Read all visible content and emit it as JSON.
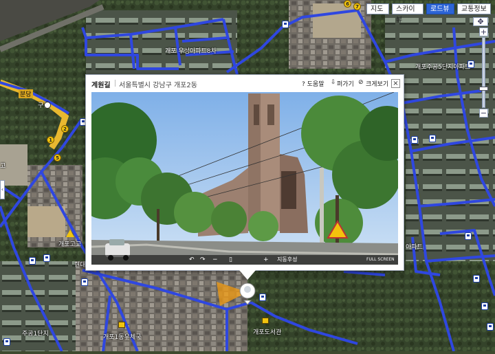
{
  "map": {
    "labels": {
      "apt8": "개포 우성아파트8차",
      "jugong5": "개포주공5단지아파트",
      "apt_right": "아파트",
      "go": "고",
      "gaepo_hs": "개포고교",
      "hyundai": "현대",
      "jugong1": "주공1단지",
      "post_office": "개포1동우체국",
      "library": "개포도서관",
      "station_left": "분당",
      "station_name": "구룡"
    },
    "route_numbers": [
      "6",
      "7",
      "1",
      "2",
      "5"
    ],
    "colors": {
      "road": "#2f47e0",
      "road_highlight": "#e8b830"
    }
  },
  "map_types": {
    "map": "지도",
    "sky": "스카이뷰",
    "road": "로드뷰",
    "traffic": "교통정보",
    "active": "road"
  },
  "zoom": {
    "plus": "+",
    "minus": "−"
  },
  "panel": {
    "title": "계원길",
    "address": "서울특별시 강남구 개포2동",
    "help": "? 도움말",
    "share": "퍼가기",
    "enlarge": "크게보기",
    "close": "×",
    "compass": "지동후성",
    "fullscreen": "FULL SCREEN"
  }
}
